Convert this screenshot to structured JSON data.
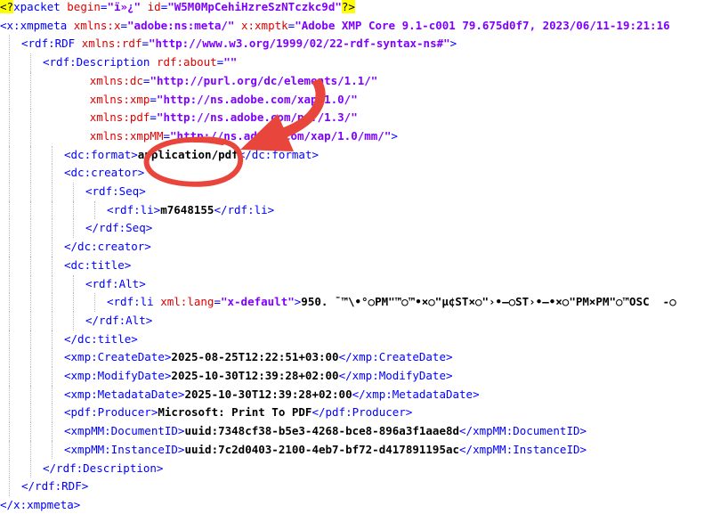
{
  "editor": {
    "lines": [
      {
        "indent": 0,
        "parts": [
          [
            "pi",
            "<?"
          ],
          [
            "tag",
            "xpacket "
          ],
          [
            "attr",
            "begin"
          ],
          [
            "tag",
            "="
          ],
          [
            "val",
            "\"ï»¿\""
          ],
          [
            "tag",
            " "
          ],
          [
            "attr",
            "id"
          ],
          [
            "tag",
            "="
          ],
          [
            "val",
            "\"W5M0MpCehiHzreSzNTczkc9d\""
          ],
          [
            "pi",
            "?>"
          ]
        ]
      },
      {
        "indent": 0,
        "parts": [
          [
            "tag",
            "<x:xmpmeta "
          ],
          [
            "attr",
            "xmlns:x"
          ],
          [
            "tag",
            "="
          ],
          [
            "val",
            "\"adobe:ns:meta/\""
          ],
          [
            "tag",
            " "
          ],
          [
            "attr",
            "x:xmptk"
          ],
          [
            "tag",
            "="
          ],
          [
            "val",
            "\"Adobe XMP Core 9.1-c001 79.675d0f7, 2023/06/11-19:21:16"
          ]
        ]
      },
      {
        "indent": 1,
        "parts": [
          [
            "tag",
            "<rdf:RDF "
          ],
          [
            "attr",
            "xmlns:rdf"
          ],
          [
            "tag",
            "="
          ],
          [
            "val",
            "\"http://www.w3.org/1999/02/22-rdf-syntax-ns#\""
          ],
          [
            "tag",
            ">"
          ]
        ]
      },
      {
        "indent": 2,
        "parts": [
          [
            "tag",
            "<rdf:Description "
          ],
          [
            "attr",
            "rdf:about"
          ],
          [
            "tag",
            "="
          ],
          [
            "val",
            "\"\""
          ]
        ]
      },
      {
        "indent": 2,
        "pad": "       ",
        "parts": [
          [
            "attr",
            "xmlns:dc"
          ],
          [
            "tag",
            "="
          ],
          [
            "val",
            "\"http://purl.org/dc/elements/1.1/\""
          ]
        ]
      },
      {
        "indent": 2,
        "pad": "       ",
        "parts": [
          [
            "attr",
            "xmlns:xmp"
          ],
          [
            "tag",
            "="
          ],
          [
            "val",
            "\"http://ns.adobe.com/xap/1.0/\""
          ]
        ]
      },
      {
        "indent": 2,
        "pad": "       ",
        "parts": [
          [
            "attr",
            "xmlns:pdf"
          ],
          [
            "tag",
            "="
          ],
          [
            "val",
            "\"http://ns.adobe.com/pdf/1.3/\""
          ]
        ]
      },
      {
        "indent": 2,
        "pad": "       ",
        "parts": [
          [
            "attr",
            "xmlns:xmpMM"
          ],
          [
            "tag",
            "="
          ],
          [
            "val",
            "\"http://ns.adobe.com/xap/1.0/mm/\""
          ],
          [
            "tag",
            ">"
          ]
        ]
      },
      {
        "indent": 3,
        "parts": [
          [
            "tag",
            "<dc:format>"
          ],
          [
            "txt",
            "application/pdf"
          ],
          [
            "tag",
            "</dc:format>"
          ]
        ]
      },
      {
        "indent": 3,
        "parts": [
          [
            "tag",
            "<dc:creator>"
          ]
        ]
      },
      {
        "indent": 4,
        "parts": [
          [
            "tag",
            "<rdf:Seq>"
          ]
        ]
      },
      {
        "indent": 5,
        "parts": [
          [
            "tag",
            "<rdf:li>"
          ],
          [
            "txt",
            "m7648155"
          ],
          [
            "tag",
            "</rdf:li>"
          ]
        ]
      },
      {
        "indent": 4,
        "parts": [
          [
            "tag",
            "</rdf:Seq>"
          ]
        ]
      },
      {
        "indent": 3,
        "parts": [
          [
            "tag",
            "</dc:creator>"
          ]
        ]
      },
      {
        "indent": 3,
        "parts": [
          [
            "tag",
            "<dc:title>"
          ]
        ]
      },
      {
        "indent": 4,
        "parts": [
          [
            "tag",
            "<rdf:Alt>"
          ]
        ]
      },
      {
        "indent": 5,
        "parts": [
          [
            "tag",
            "<rdf:li "
          ],
          [
            "attr",
            "xml:lang"
          ],
          [
            "tag",
            "="
          ],
          [
            "val",
            "\"x-default\""
          ],
          [
            "tag",
            ">"
          ],
          [
            "glitch",
            "950. ¯™\\•°○PM\"™○™•×○\"µ¢ST×○\"›•—○ST›•—•×○\"PM×PM\"○™OSC  -○"
          ]
        ]
      },
      {
        "indent": 4,
        "parts": [
          [
            "tag",
            "</rdf:Alt>"
          ]
        ]
      },
      {
        "indent": 3,
        "parts": [
          [
            "tag",
            "</dc:title>"
          ]
        ]
      },
      {
        "indent": 3,
        "parts": [
          [
            "tag",
            "<xmp:CreateDate>"
          ],
          [
            "txt",
            "2025-08-25T12:22:51+03:00"
          ],
          [
            "tag",
            "</xmp:CreateDate>"
          ]
        ]
      },
      {
        "indent": 3,
        "parts": [
          [
            "tag",
            "<xmp:ModifyDate>"
          ],
          [
            "txt",
            "2025-10-30T12:39:28+02:00"
          ],
          [
            "tag",
            "</xmp:ModifyDate>"
          ]
        ]
      },
      {
        "indent": 3,
        "parts": [
          [
            "tag",
            "<xmp:MetadataDate>"
          ],
          [
            "txt",
            "2025-10-30T12:39:28+02:00"
          ],
          [
            "tag",
            "</xmp:MetadataDate>"
          ]
        ]
      },
      {
        "indent": 3,
        "parts": [
          [
            "tag",
            "<pdf:Producer>"
          ],
          [
            "txt",
            "Microsoft: Print To PDF"
          ],
          [
            "tag",
            "</pdf:Producer>"
          ]
        ]
      },
      {
        "indent": 3,
        "parts": [
          [
            "tag",
            "<xmpMM:DocumentID>"
          ],
          [
            "txt",
            "uuid:7348cf38-b5e3-4268-bce8-896a3f1aae8d"
          ],
          [
            "tag",
            "</xmpMM:DocumentID>"
          ]
        ]
      },
      {
        "indent": 3,
        "parts": [
          [
            "tag",
            "<xmpMM:InstanceID>"
          ],
          [
            "txt",
            "uuid:7c2d0403-2100-4eb7-bf72-d417891195ac"
          ],
          [
            "tag",
            "</xmpMM:InstanceID>"
          ]
        ]
      },
      {
        "indent": 2,
        "parts": [
          [
            "tag",
            "</rdf:Description>"
          ]
        ]
      },
      {
        "indent": 1,
        "parts": [
          [
            "tag",
            "</rdf:RDF>"
          ]
        ]
      },
      {
        "indent": 0,
        "parts": [
          [
            "tag",
            "</x:xmpmeta>"
          ]
        ]
      }
    ]
  },
  "annotation": {
    "type": "red-circle-and-arrow",
    "color": "#e8463c",
    "target_text": "m7648155"
  }
}
